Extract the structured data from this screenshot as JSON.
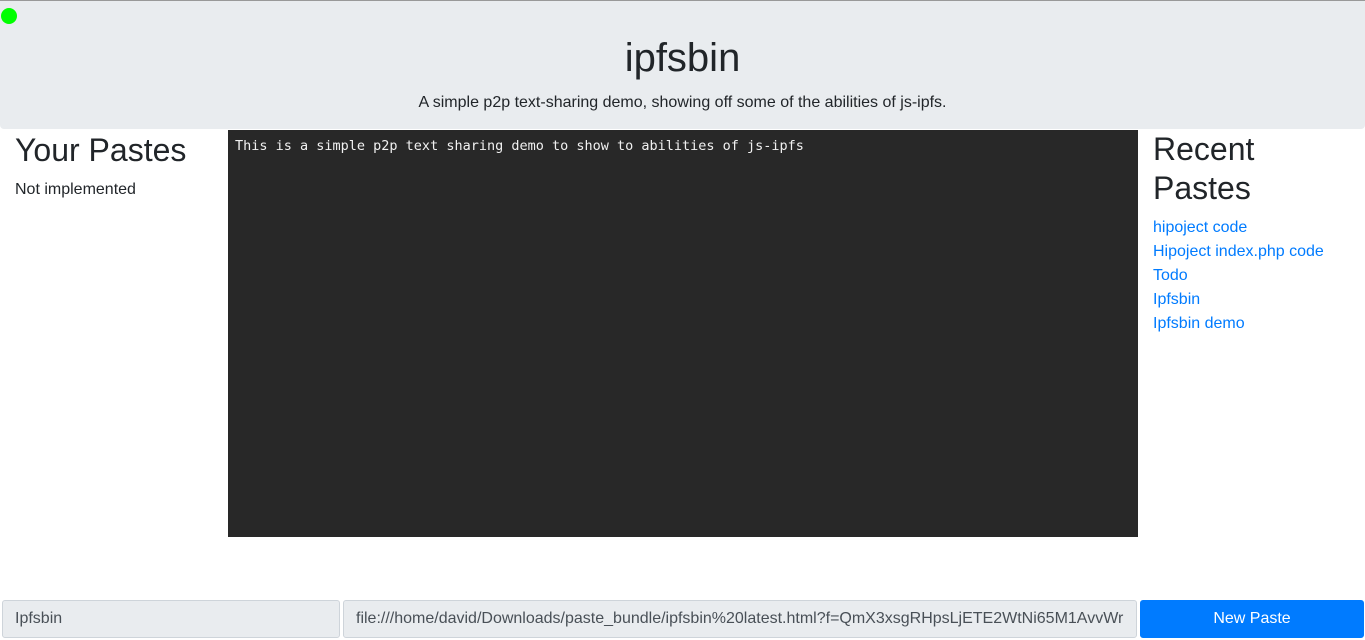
{
  "header": {
    "title": "ipfsbin",
    "subtitle": "A simple p2p text-sharing demo, showing off some of the abilities of js-ipfs.",
    "status_color": "#00ff00"
  },
  "your_pastes": {
    "heading": "Your Pastes",
    "message": "Not implemented"
  },
  "editor": {
    "content": "This is a simple p2p text sharing demo to show to abilities of js-ipfs"
  },
  "recent_pastes": {
    "heading": "Recent Pastes",
    "items": [
      {
        "label": "hipoject code"
      },
      {
        "label": "Hipoject index.php code"
      },
      {
        "label": "Todo"
      },
      {
        "label": "Ipfsbin"
      },
      {
        "label": "Ipfsbin demo"
      }
    ]
  },
  "bottom": {
    "title_value": "Ipfsbin",
    "url_value": "file:///home/david/Downloads/paste_bundle/ipfsbin%20latest.html?f=QmX3xsgRHpsLjETE2WtNi65M1AvvWr",
    "new_paste_label": "New Paste"
  },
  "colors": {
    "accent": "#007bff",
    "jumbotron_bg": "#e9ecef",
    "editor_bg": "#282828"
  }
}
